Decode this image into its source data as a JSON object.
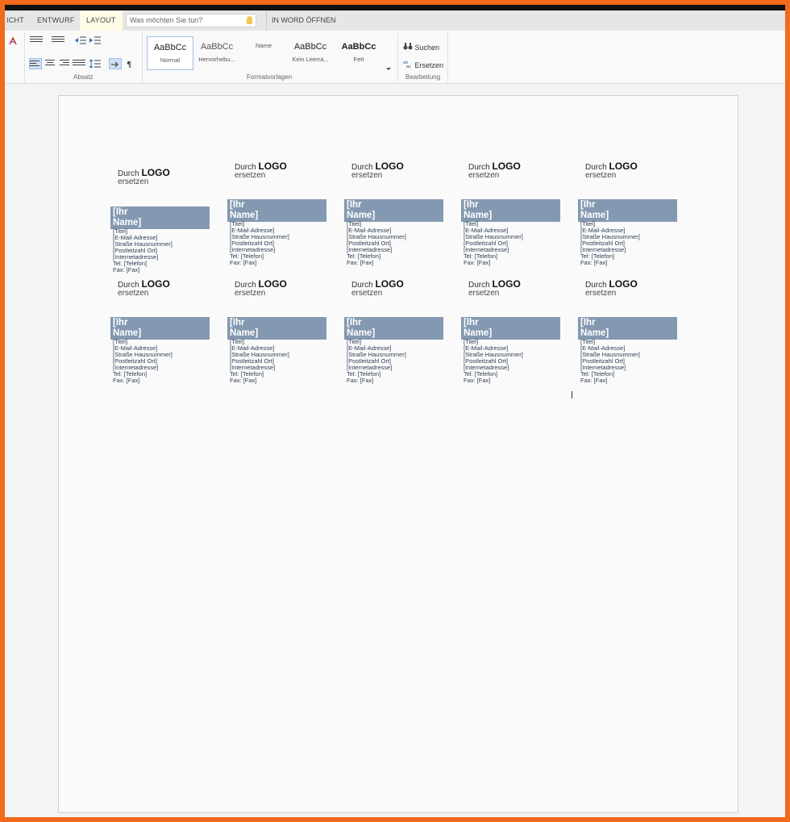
{
  "tabs": [
    {
      "label": "ICHT",
      "active": false
    },
    {
      "label": "ENTWURF",
      "active": false
    },
    {
      "label": "LAYOUT",
      "active": true
    }
  ],
  "tell_me": {
    "placeholder": "Was möchten Sie tun?",
    "icon": "lightbulb-icon"
  },
  "open_in_word": "IN WORD ÖFFNEN",
  "ribbon": {
    "paragraph_group": "Absatz",
    "styles_group": "Formatvorlagen",
    "edit_group": "Bearbeitung",
    "styles": [
      {
        "preview": "AaBbCc",
        "label": "Normal",
        "active": true
      },
      {
        "preview": "AaBbCc",
        "label": "Hervorhebu...",
        "active": false
      },
      {
        "preview": "",
        "label": "Name",
        "active": false
      },
      {
        "preview": "AaBbCc",
        "label": "Kein Leerra...",
        "active": false
      },
      {
        "preview": "AaBbCc",
        "label": "Fett",
        "active": false
      }
    ],
    "search": "Suchen",
    "replace": "Ersetzen"
  },
  "card": {
    "logo_prefix": "Durch",
    "logo_word": "LOGO",
    "logo_suffix": "ersetzen",
    "name_line1": "[Ihr",
    "name_line2": "Name]",
    "title": "[Titel]",
    "email": "[E-Mail-Adresse]",
    "street": "[Straße Hausnummer]",
    "postal": "[Postleitzahl Ort]",
    "web": "[Internetadresse]",
    "tel": "Tel:  [Telefon]",
    "fax": "Fax:  [Fax]"
  },
  "colors": {
    "name_bar": "#8499b1",
    "accent_border": "#f26a1b"
  }
}
